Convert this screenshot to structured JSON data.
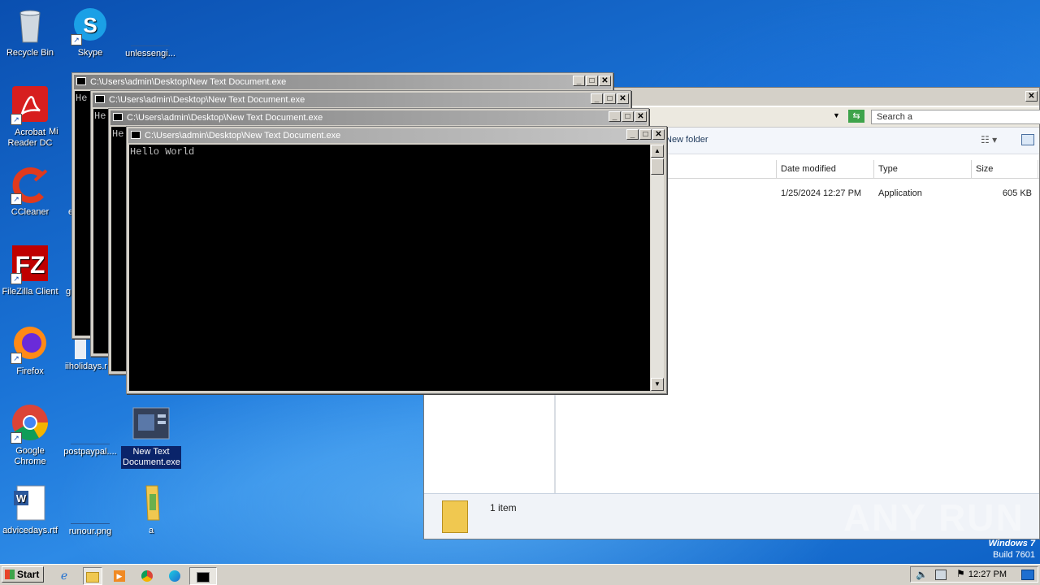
{
  "desktop": {
    "icons": [
      {
        "label": "Recycle Bin"
      },
      {
        "label": "Skype"
      },
      {
        "label": "unlessengi..."
      },
      {
        "label": "Acrobat Reader DC"
      },
      {
        "label": "Mi"
      },
      {
        "label": "CCleaner"
      },
      {
        "label": "e"
      },
      {
        "label": "FileZilla Client"
      },
      {
        "label": "g"
      },
      {
        "label": "Firefox"
      },
      {
        "label": "iiholidays.r"
      },
      {
        "label": "Google Chrome"
      },
      {
        "label": "postpaypal...."
      },
      {
        "label": "New Text Document.exe"
      },
      {
        "label": "advicedays.rtf"
      },
      {
        "label": "runour.png"
      },
      {
        "label": "a"
      }
    ]
  },
  "explorer": {
    "search_placeholder": "Search a",
    "toolbar_new_folder": "New folder",
    "columns": [
      "Date modified",
      "Type",
      "Size"
    ],
    "row": {
      "date": "1/25/2024 12:27 PM",
      "type": "Application",
      "size": "605 KB"
    },
    "status": "1 item"
  },
  "consoles": [
    {
      "title": "C:\\Users\\admin\\Desktop\\New Text Document.exe",
      "output": "He"
    },
    {
      "title": "C:\\Users\\admin\\Desktop\\New Text Document.exe",
      "output": "He"
    },
    {
      "title": "C:\\Users\\admin\\Desktop\\New Text Document.exe",
      "output": "He"
    },
    {
      "title": "C:\\Users\\admin\\Desktop\\New Text Document.exe",
      "output": "Hello World"
    }
  ],
  "taskbar": {
    "start_label": "Start",
    "clock": "12:27 PM"
  },
  "watermark": "ANY RUN",
  "os_info": {
    "line1": "Windows 7",
    "line2": "Build 7601"
  }
}
